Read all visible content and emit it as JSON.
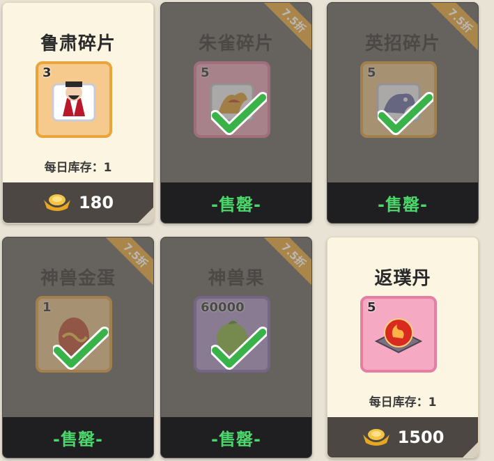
{
  "cards": [
    {
      "title": "鲁肃碎片",
      "count": "3",
      "stock": "每日库存：1",
      "price": "180",
      "frame": "orange",
      "status": "active",
      "art": "general-portrait-icon"
    },
    {
      "title": "朱雀碎片",
      "count": "5",
      "discount": "7.5折",
      "sold_text": "-售罄-",
      "frame": "pink",
      "status": "sold",
      "art": "phoenix-fragment-icon"
    },
    {
      "title": "英招碎片",
      "count": "5",
      "discount": "7.5折",
      "sold_text": "-售罄-",
      "frame": "orange",
      "status": "sold",
      "art": "beast-fragment-icon"
    },
    {
      "title": "神兽金蛋",
      "count": "1",
      "discount": "7.5折",
      "sold_text": "-售罄-",
      "frame": "orange",
      "status": "sold",
      "art": "golden-egg-icon"
    },
    {
      "title": "神兽果",
      "count": "60000",
      "discount": "7.5折",
      "sold_text": "-售罄-",
      "frame": "purple",
      "status": "sold",
      "art": "beast-fruit-icon"
    },
    {
      "title": "返璞丹",
      "count": "5",
      "stock": "每日库存：1",
      "price": "1500",
      "frame": "pink",
      "status": "active",
      "art": "fire-orb-icon"
    }
  ],
  "colors": {
    "gold": "#f4c542",
    "sold_green": "#4cd76a",
    "discount_orange": "#e2a43a"
  }
}
